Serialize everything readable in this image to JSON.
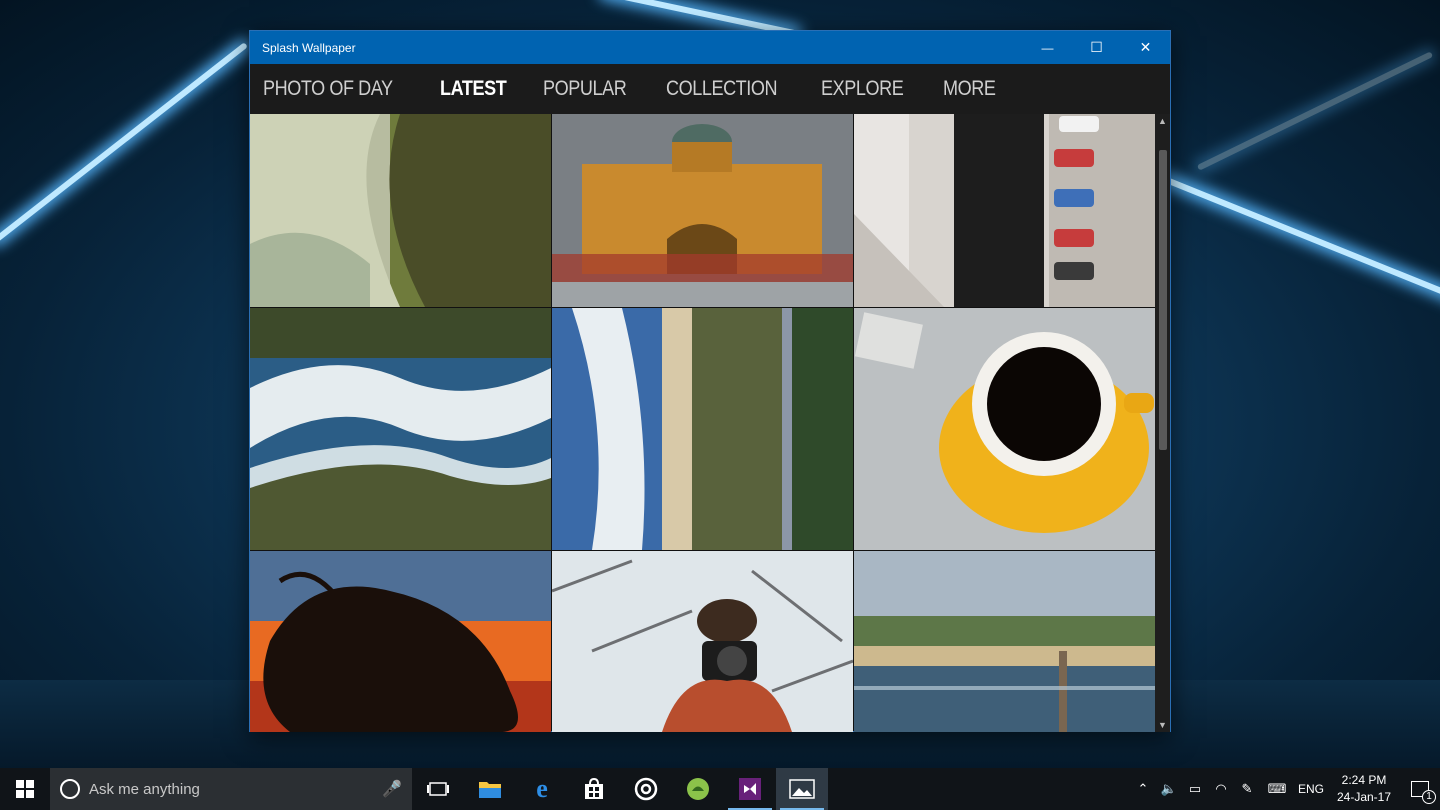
{
  "window": {
    "title": "Splash Wallpaper",
    "minimize": "—",
    "maximize": "☐",
    "close": "✕"
  },
  "nav": {
    "items": [
      {
        "label": "PHOTO OF DAY",
        "active": false
      },
      {
        "label": "LATEST",
        "active": true
      },
      {
        "label": "POPULAR",
        "active": false
      },
      {
        "label": "COLLECTION",
        "active": false
      },
      {
        "label": "EXPLORE",
        "active": false
      },
      {
        "label": "MORE",
        "active": false
      }
    ]
  },
  "photos": [
    {
      "subject": "wave-curl",
      "colors": [
        "#c9cdb0",
        "#6f7b3c",
        "#3e3b22"
      ]
    },
    {
      "subject": "railway-station",
      "colors": [
        "#c98a2e",
        "#8b5a1c",
        "#6f7479"
      ]
    },
    {
      "subject": "aerial-parking",
      "colors": [
        "#d6d3cf",
        "#1d1d1d",
        "#b8b2aa"
      ]
    },
    {
      "subject": "aerial-surf",
      "colors": [
        "#2b5d86",
        "#e8eef1",
        "#4f5832"
      ]
    },
    {
      "subject": "aerial-coast-road",
      "colors": [
        "#3a6aa8",
        "#d8c9a8",
        "#2f4a2a"
      ]
    },
    {
      "subject": "coffee-cup",
      "colors": [
        "#bfc2c3",
        "#f0b21b",
        "#0b0604"
      ]
    },
    {
      "subject": "hair-sunset",
      "colors": [
        "#5b7da6",
        "#e86a22",
        "#1a0f0a"
      ]
    },
    {
      "subject": "photographer-snow",
      "colors": [
        "#dfe6ea",
        "#6d6f72",
        "#b84e2e"
      ]
    },
    {
      "subject": "beach-pier",
      "colors": [
        "#a8b7c4",
        "#cdb98e",
        "#3f5f78"
      ]
    }
  ],
  "taskbar": {
    "search_placeholder": "Ask me anything",
    "apps": [
      "task-view",
      "file-explorer",
      "edge",
      "store",
      "groove",
      "android",
      "visual-studio",
      "photos"
    ],
    "tray_lang": "ENG",
    "time": "2:24 PM",
    "date": "24-Jan-17",
    "notification_count": "1"
  }
}
